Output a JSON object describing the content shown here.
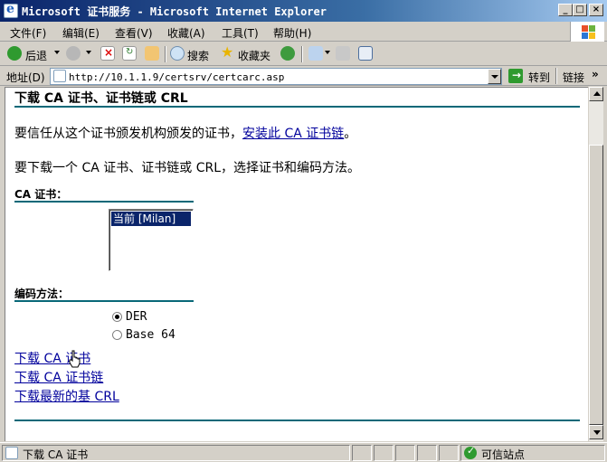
{
  "window": {
    "title": "Microsoft 证书服务 - Microsoft Internet Explorer"
  },
  "menu": [
    "文件(F)",
    "编辑(E)",
    "查看(V)",
    "收藏(A)",
    "工具(T)",
    "帮助(H)"
  ],
  "toolbar": {
    "back": "后退",
    "search": "搜索",
    "favorites": "收藏夹"
  },
  "address": {
    "label": "地址(D)",
    "url": "http://10.1.1.9/certsrv/certcarc.asp",
    "go": "转到",
    "links": "链接"
  },
  "page": {
    "heading": "下载 CA 证书、证书链或 CRL",
    "trust_text": "要信任从这个证书颁发机构颁发的证书，",
    "trust_link": "安装此 CA 证书链",
    "trust_end": "。",
    "instruction": "要下载一个 CA 证书、证书链或 CRL，选择证书和编码方法。",
    "ca_label": "CA 证书：",
    "ca_options": [
      "当前 [Milan]"
    ],
    "encoding_label": "编码方法：",
    "encoding_options": [
      {
        "label": "DER",
        "selected": true
      },
      {
        "label": "Base 64",
        "selected": false
      }
    ],
    "links": [
      "下载 CA 证书",
      "下载 CA 证书链",
      "下载最新的基 CRL"
    ]
  },
  "status": {
    "text": "下载 CA 证书",
    "zone": "可信站点"
  },
  "colors": {
    "accent_rule": "#086878",
    "link": "#00009c",
    "title_bar": "#0a246a"
  }
}
